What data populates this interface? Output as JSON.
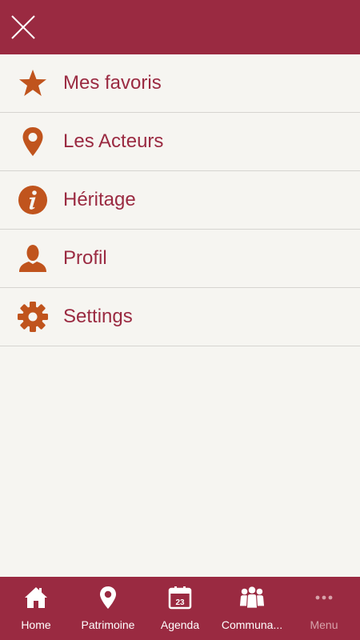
{
  "colors": {
    "brand": "#9a2a41",
    "icon_accent": "#c0541d",
    "background": "#f6f5f1",
    "divider": "#d6d4d0"
  },
  "header": {
    "close_icon": "close-icon"
  },
  "menu": {
    "items": [
      {
        "label": "Mes favoris",
        "icon": "star-icon"
      },
      {
        "label": "Les Acteurs",
        "icon": "map-pin-icon"
      },
      {
        "label": "Héritage",
        "icon": "info-icon"
      },
      {
        "label": "Profil",
        "icon": "user-icon"
      },
      {
        "label": "Settings",
        "icon": "gear-icon"
      }
    ]
  },
  "bottom_nav": {
    "items": [
      {
        "label": "Home",
        "icon": "home-icon"
      },
      {
        "label": "Patrimoine",
        "icon": "map-pin-icon"
      },
      {
        "label": "Agenda",
        "icon": "calendar-icon",
        "day": "23"
      },
      {
        "label": "Communa...",
        "icon": "community-icon"
      },
      {
        "label": "Menu",
        "icon": "more-icon",
        "active": true
      }
    ]
  }
}
